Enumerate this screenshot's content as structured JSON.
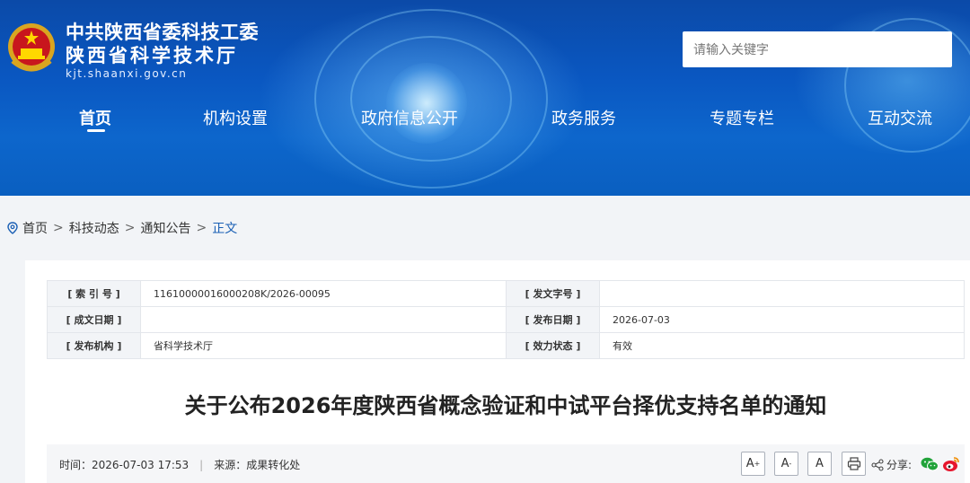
{
  "header": {
    "name_line1": "中共陕西省委科技工委",
    "name_line2": "陕西省科学技术厅",
    "domain": "kjt.shaanxi.gov.cn",
    "search_placeholder": "请输入关键字",
    "icons": [
      "national-emblem-icon"
    ]
  },
  "nav": {
    "items": [
      {
        "label": "首页",
        "active": true
      },
      {
        "label": "机构设置"
      },
      {
        "label": "政府信息公开"
      },
      {
        "label": "政务服务"
      },
      {
        "label": "专题专栏"
      },
      {
        "label": "互动交流"
      }
    ]
  },
  "breadcrumb": {
    "items": [
      "首页",
      "科技动态",
      "通知公告"
    ],
    "current": "正文",
    "separator": ">"
  },
  "meta": {
    "index_label": "[ 索 引 号 ]",
    "index_value": "11610000016000208K/2026-00095",
    "docno_label": "[ 发文字号 ]",
    "docno_value": "",
    "created_label": "[ 成文日期 ]",
    "created_value": "",
    "published_label": "[ 发布日期 ]",
    "published_value": "2026-07-03",
    "org_label": "[ 发布机构 ]",
    "org_value": "省科学技术厅",
    "status_label": "[ 效力状态 ]",
    "status_value": "有效",
    "status_color": "#19a34a"
  },
  "article": {
    "title": "关于公布2026年度陕西省概念验证和中试平台择优支持名单的通知",
    "time_label": "时间：",
    "time_value": "2026-07-03 17:53",
    "divider": "|",
    "source_label": "来源：",
    "source_value": "成果转化处"
  },
  "toolbar": {
    "font_large": "A",
    "font_small": "A",
    "font_default": "A",
    "share_label": "分享:",
    "icons": [
      "print-icon",
      "share-icon",
      "wechat-icon",
      "weibo-icon"
    ]
  },
  "colors": {
    "banner": "#0a57c1",
    "link": "#1a5fb4"
  }
}
